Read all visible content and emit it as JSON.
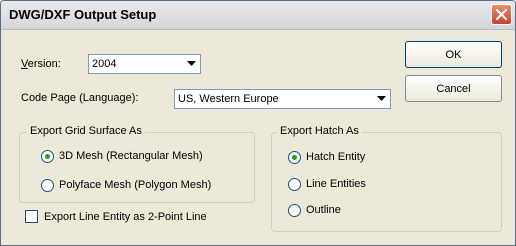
{
  "window": {
    "title": "DWG/DXF Output Setup"
  },
  "version": {
    "label": "Version:",
    "value": "2004"
  },
  "code_page": {
    "label": "Code Page (Language):",
    "value": "US, Western Europe"
  },
  "buttons": {
    "ok": "OK",
    "cancel": "Cancel"
  },
  "grid_group": {
    "title": "Export Grid Surface As",
    "options": [
      {
        "label": "3D Mesh (Rectangular Mesh)",
        "selected": true
      },
      {
        "label": "Polyface Mesh (Polygon Mesh)",
        "selected": false
      }
    ]
  },
  "line_entity": {
    "label": "Export Line Entity as 2-Point Line",
    "checked": false
  },
  "hatch_group": {
    "title": "Export Hatch As",
    "options": [
      {
        "label": "Hatch Entity",
        "selected": true
      },
      {
        "label": "Line Entities",
        "selected": false
      },
      {
        "label": "Outline",
        "selected": false
      }
    ]
  },
  "icons": {
    "close": "close-icon",
    "dropdown": "chevron-down-icon"
  },
  "colors": {
    "close_button": "#c9452b",
    "radio_selected": "#21a121",
    "window_bg": "#ece9d8"
  }
}
